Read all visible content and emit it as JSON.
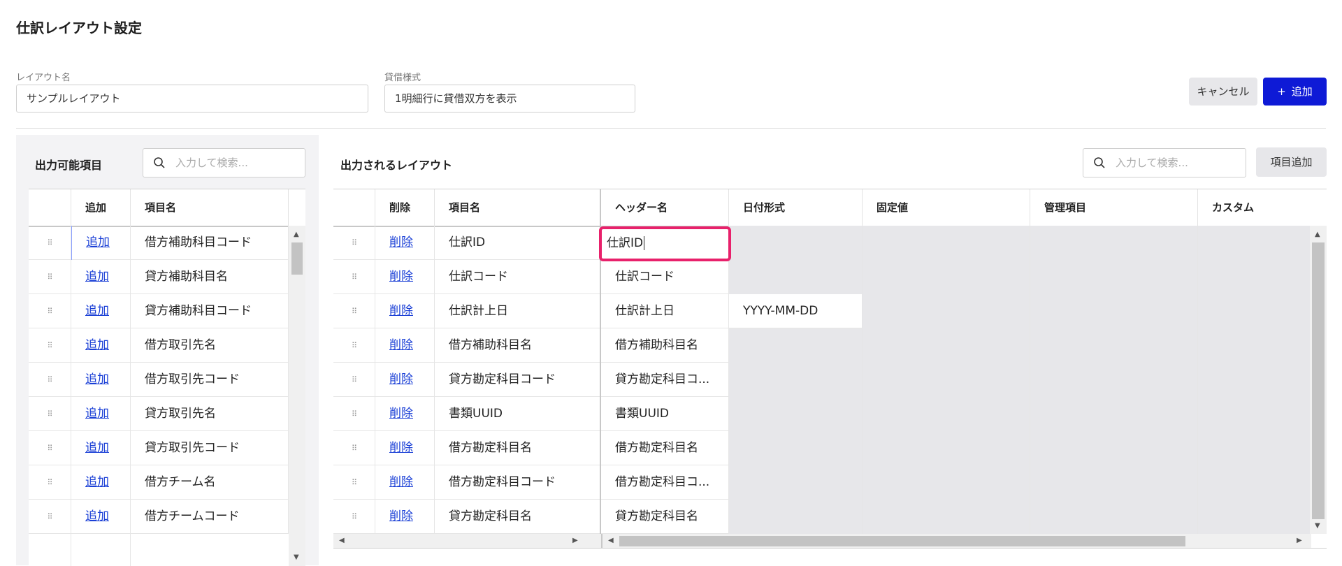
{
  "page_title": "仕訳レイアウト設定",
  "form": {
    "layout_name_label": "レイアウト名",
    "layout_name_value": "サンプルレイアウト",
    "debit_credit_label": "貸借様式",
    "debit_credit_value": "1明細行に貸借双方を表示"
  },
  "actions": {
    "cancel": "キャンセル",
    "add": "追加",
    "add_icon": "+"
  },
  "left_panel": {
    "title": "出力可能項目",
    "search_placeholder": "入力して検索...",
    "columns": [
      "追加",
      "項目名"
    ],
    "rows": [
      {
        "action": "追加",
        "name": "借方補助科目コード"
      },
      {
        "action": "追加",
        "name": "貸方補助科目名"
      },
      {
        "action": "追加",
        "name": "貸方補助科目コード"
      },
      {
        "action": "追加",
        "name": "借方取引先名"
      },
      {
        "action": "追加",
        "name": "借方取引先コード"
      },
      {
        "action": "追加",
        "name": "貸方取引先名"
      },
      {
        "action": "追加",
        "name": "貸方取引先コード"
      },
      {
        "action": "追加",
        "name": "借方チーム名"
      },
      {
        "action": "追加",
        "name": "借方チームコード"
      }
    ]
  },
  "right_panel": {
    "title": "出力されるレイアウト",
    "search_placeholder": "入力して検索...",
    "add_item_button": "項目追加",
    "columns": [
      "削除",
      "項目名",
      "ヘッダー名",
      "日付形式",
      "固定値",
      "管理項目",
      "カスタム"
    ],
    "rows": [
      {
        "action": "削除",
        "name": "仕訳ID",
        "header": "仕訳ID",
        "date_format": ""
      },
      {
        "action": "削除",
        "name": "仕訳コード",
        "header": "仕訳コード",
        "date_format": ""
      },
      {
        "action": "削除",
        "name": "仕訳計上日",
        "header": "仕訳計上日",
        "date_format": "YYYY-MM-DD"
      },
      {
        "action": "削除",
        "name": "借方補助科目名",
        "header": "借方補助科目名",
        "date_format": ""
      },
      {
        "action": "削除",
        "name": "貸方勘定科目コード",
        "header": "貸方勘定科目コ...",
        "date_format": ""
      },
      {
        "action": "削除",
        "name": "書類UUID",
        "header": "書類UUID",
        "date_format": ""
      },
      {
        "action": "削除",
        "name": "借方勘定科目名",
        "header": "借方勘定科目名",
        "date_format": ""
      },
      {
        "action": "削除",
        "name": "借方勘定科目コード",
        "header": "借方勘定科目コ...",
        "date_format": ""
      },
      {
        "action": "削除",
        "name": "貸方勘定科目名",
        "header": "貸方勘定科目名",
        "date_format": ""
      }
    ]
  },
  "icons": {
    "drag_handle": "⠿",
    "search": "search-icon"
  },
  "colors": {
    "primary": "#0e1ad6",
    "focus_border": "#e8216b",
    "link": "#1a3fd6",
    "disabled_cell": "#e7e7ea"
  }
}
